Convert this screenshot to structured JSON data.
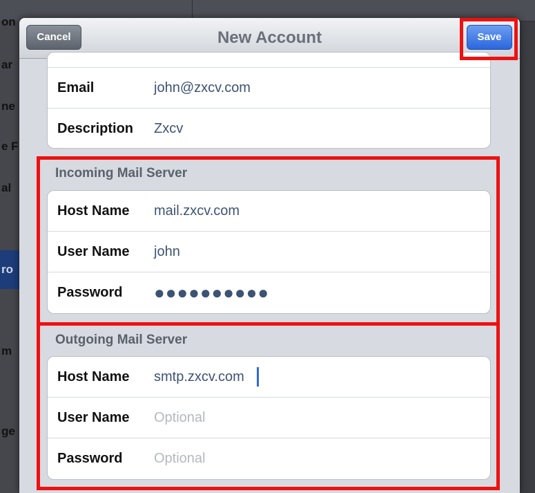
{
  "navbar": {
    "title": "New Account",
    "cancel_label": "Cancel",
    "save_label": "Save"
  },
  "background": {
    "fragments": [
      "on",
      "ar",
      "ne",
      "e F",
      "al",
      "ro",
      "m",
      "ge"
    ]
  },
  "account": {
    "email": {
      "label": "Email",
      "value": "john@zxcv.com"
    },
    "description": {
      "label": "Description",
      "value": "Zxcv"
    }
  },
  "incoming": {
    "header": "Incoming Mail Server",
    "host": {
      "label": "Host Name",
      "value": "mail.zxcv.com"
    },
    "user": {
      "label": "User Name",
      "value": "john"
    },
    "password": {
      "label": "Password",
      "value": "●●●●●●●●●●"
    }
  },
  "outgoing": {
    "header": "Outgoing Mail Server",
    "host": {
      "label": "Host Name",
      "value": "smtp.zxcv.com"
    },
    "user": {
      "label": "User Name",
      "placeholder": "Optional"
    },
    "password": {
      "label": "Password",
      "placeholder": "Optional"
    }
  },
  "colors": {
    "highlight": "#ee1111",
    "save_button": "#2a66dd",
    "value_text": "#3d5373"
  }
}
